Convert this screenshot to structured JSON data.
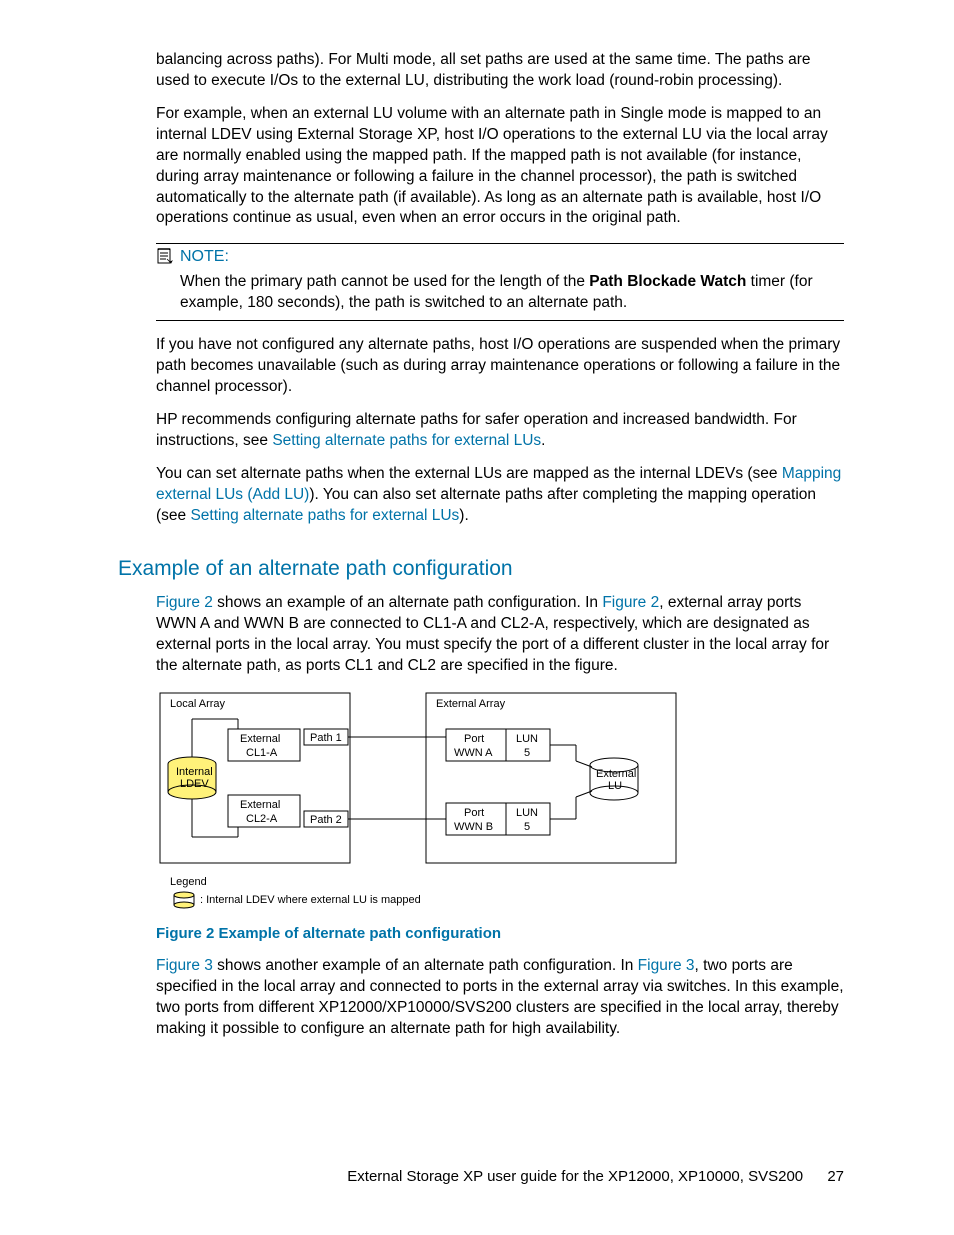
{
  "para1": "balancing across paths). For Multi mode, all set paths are used at the same time. The paths are used to execute I/Os to the external LU, distributing the work load (round-robin processing).",
  "para2": "For example, when an external LU volume with an alternate path in Single mode is mapped to an internal LDEV using External Storage XP, host I/O operations to the external LU via the local array are normally enabled using the mapped path. If the mapped path is not available (for instance, during array maintenance or following a failure in the channel processor), the path is switched automatically to the alternate path (if available). As long as an alternate path is available, host I/O operations continue as usual, even when an error occurs in the original path.",
  "note": {
    "label": "NOTE:",
    "body_pre": "When the primary path cannot be used for the length of the ",
    "body_bold": "Path Blockade Watch",
    "body_post": " timer (for example, 180 seconds), the path is switched to an alternate path."
  },
  "para3": "If you have not configured any alternate paths, host I/O operations are suspended when the primary path becomes unavailable (such as during array maintenance operations or following a failure in the channel processor).",
  "para4_pre": "HP recommends configuring alternate paths for safer operation and increased bandwidth. For instructions, see ",
  "para4_link": "Setting alternate paths for external LUs",
  "para4_post": ".",
  "para5_pre": "You can set alternate paths when the external LUs are mapped as the internal LDEVs (see ",
  "para5_link1": "Mapping external LUs (Add LU)",
  "para5_mid": "). You can also set alternate paths after completing the mapping operation (see ",
  "para5_link2": "Setting alternate paths for external LUs",
  "para5_post": ").",
  "section_heading": "Example of an alternate path configuration",
  "sec_p1_link1": "Figure 2",
  "sec_p1_mid1": " shows an example of an alternate path configuration. In ",
  "sec_p1_link2": "Figure 2",
  "sec_p1_post": ", external array ports WWN A and WWN B are connected to CL1-A and CL2-A, respectively, which are designated as external ports in the local array. You must specify the port of a different cluster in the local array for the alternate path, as ports CL1 and CL2 are specified in the figure.",
  "figure2_caption": "Figure 2 Example of alternate path configuration",
  "sec_p2_link1": "Figure 3",
  "sec_p2_mid1": " shows another example of an alternate path configuration. In ",
  "sec_p2_link2": "Figure 3",
  "sec_p2_post": ", two ports are specified in the local array and connected to ports in the external array via switches. In this example, two ports from different XP12000/XP10000/SVS200 clusters are specified in the local array, thereby making it possible to configure an alternate path for high availability.",
  "diagram": {
    "local_array": "Local Array",
    "external_array": "External Array",
    "internal_ldev": "Internal\nLDEV",
    "external_lu": "External\nLU",
    "external_label": "External",
    "cl1a": "CL1-A",
    "cl2a": "CL2-A",
    "path1": "Path 1",
    "path2": "Path 2",
    "port": "Port",
    "wwn_a": "WWN A",
    "wwn_b": "WWN B",
    "lun": "LUN",
    "lun_val": "5",
    "legend": "Legend",
    "legend_text": ": Internal LDEV where external LU is mapped"
  },
  "footer": {
    "title": "External Storage XP user guide for the XP12000, XP10000, SVS200",
    "page": "27"
  }
}
